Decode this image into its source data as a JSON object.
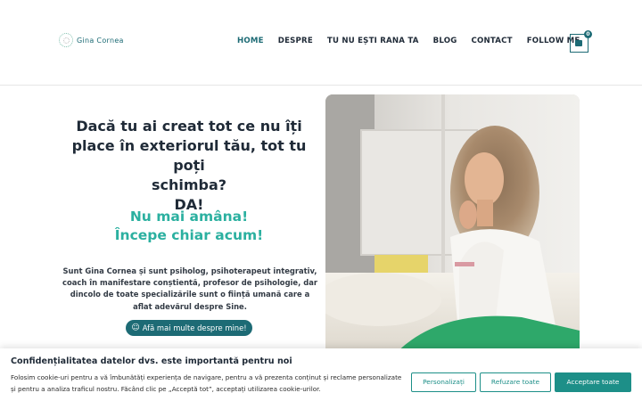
{
  "header": {
    "logo_text": "Gina Cornea",
    "nav": [
      {
        "label": "HOME",
        "active": true
      },
      {
        "label": "DESPRE"
      },
      {
        "label": "TU NU EȘTI RANA TA"
      },
      {
        "label": "BLOG"
      },
      {
        "label": "CONTACT"
      },
      {
        "label": "FOLLOW ME"
      }
    ],
    "cart_count": "0"
  },
  "hero": {
    "title_lines": [
      "Dacă tu ai creat tot ce nu îți",
      "place în exteriorul tău, tot tu poți",
      "schimba?",
      "DA!"
    ],
    "sub_lines": [
      "Nu mai amâna!",
      "Începe chiar acum!"
    ],
    "description": "Sunt Gina Cornea și sunt psiholog, psihoterapeut integrativ, coach în manifestare conștientă, profesor de psihologie, dar dincolo de toate specializările sunt o ființă umană care a aflat adevărul despre Sine.",
    "button_label": "Afă mai multe despre mine!",
    "button_icon": "☺"
  },
  "cookie": {
    "title": "Confidențialitatea datelor dvs. este importantă pentru noi",
    "text": "Folosim cookie-uri pentru a vă îmbunătăți experiența de navigare, pentru a vă prezenta conținut și reclame personalizate și pentru a analiza traficul nostru. Făcând clic pe „Acceptă tot”, acceptați utilizarea cookie-urilor.",
    "buttons": {
      "customize": "Personalizați",
      "reject": "Refuzare toate",
      "accept": "Acceptare toate"
    }
  },
  "colors": {
    "brand_teal": "#1d6b75",
    "accent_green": "#2bb0a0",
    "cookie_teal": "#1d8f88"
  }
}
